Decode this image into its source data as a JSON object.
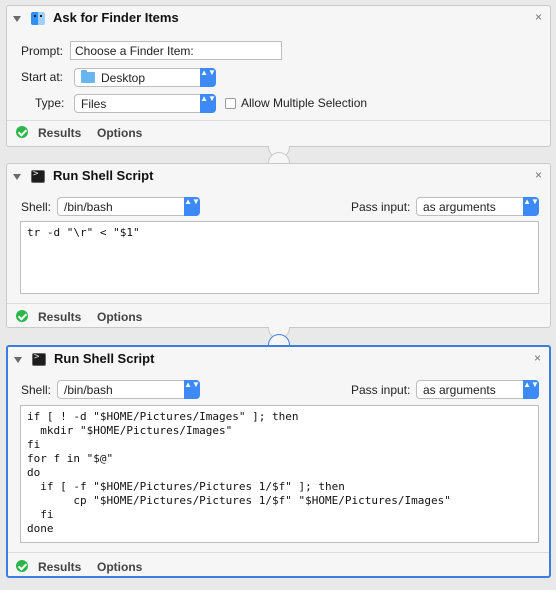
{
  "actions": [
    {
      "title": "Ask for Finder Items",
      "prompt_label": "Prompt:",
      "prompt_value": "Choose a Finder Item:",
      "start_at_label": "Start at:",
      "start_at_value": "Desktop",
      "type_label": "Type:",
      "type_value": "Files",
      "allow_multiple_label": "Allow Multiple Selection",
      "allow_multiple_checked": false,
      "results_label": "Results",
      "options_label": "Options"
    },
    {
      "title": "Run Shell Script",
      "shell_label": "Shell:",
      "shell_value": "/bin/bash",
      "pass_input_label": "Pass input:",
      "pass_input_value": "as arguments",
      "script": "tr -d \"\\r\" < \"$1\"",
      "results_label": "Results",
      "options_label": "Options"
    },
    {
      "title": "Run Shell Script",
      "shell_label": "Shell:",
      "shell_value": "/bin/bash",
      "pass_input_label": "Pass input:",
      "pass_input_value": "as arguments",
      "script": "if [ ! -d \"$HOME/Pictures/Images\" ]; then\n  mkdir \"$HOME/Pictures/Images\"\nfi\nfor f in \"$@\"\ndo\n  if [ -f \"$HOME/Pictures/Pictures 1/$f\" ]; then\n       cp \"$HOME/Pictures/Pictures 1/$f\" \"$HOME/Pictures/Images\"\n  fi\ndone",
      "results_label": "Results",
      "options_label": "Options"
    }
  ],
  "icons": {
    "close": "×",
    "popup_arrows": "▲▼"
  },
  "colors": {
    "accent": "#3d7de0",
    "popup": "#3d8af7",
    "ok": "#2db54a"
  }
}
